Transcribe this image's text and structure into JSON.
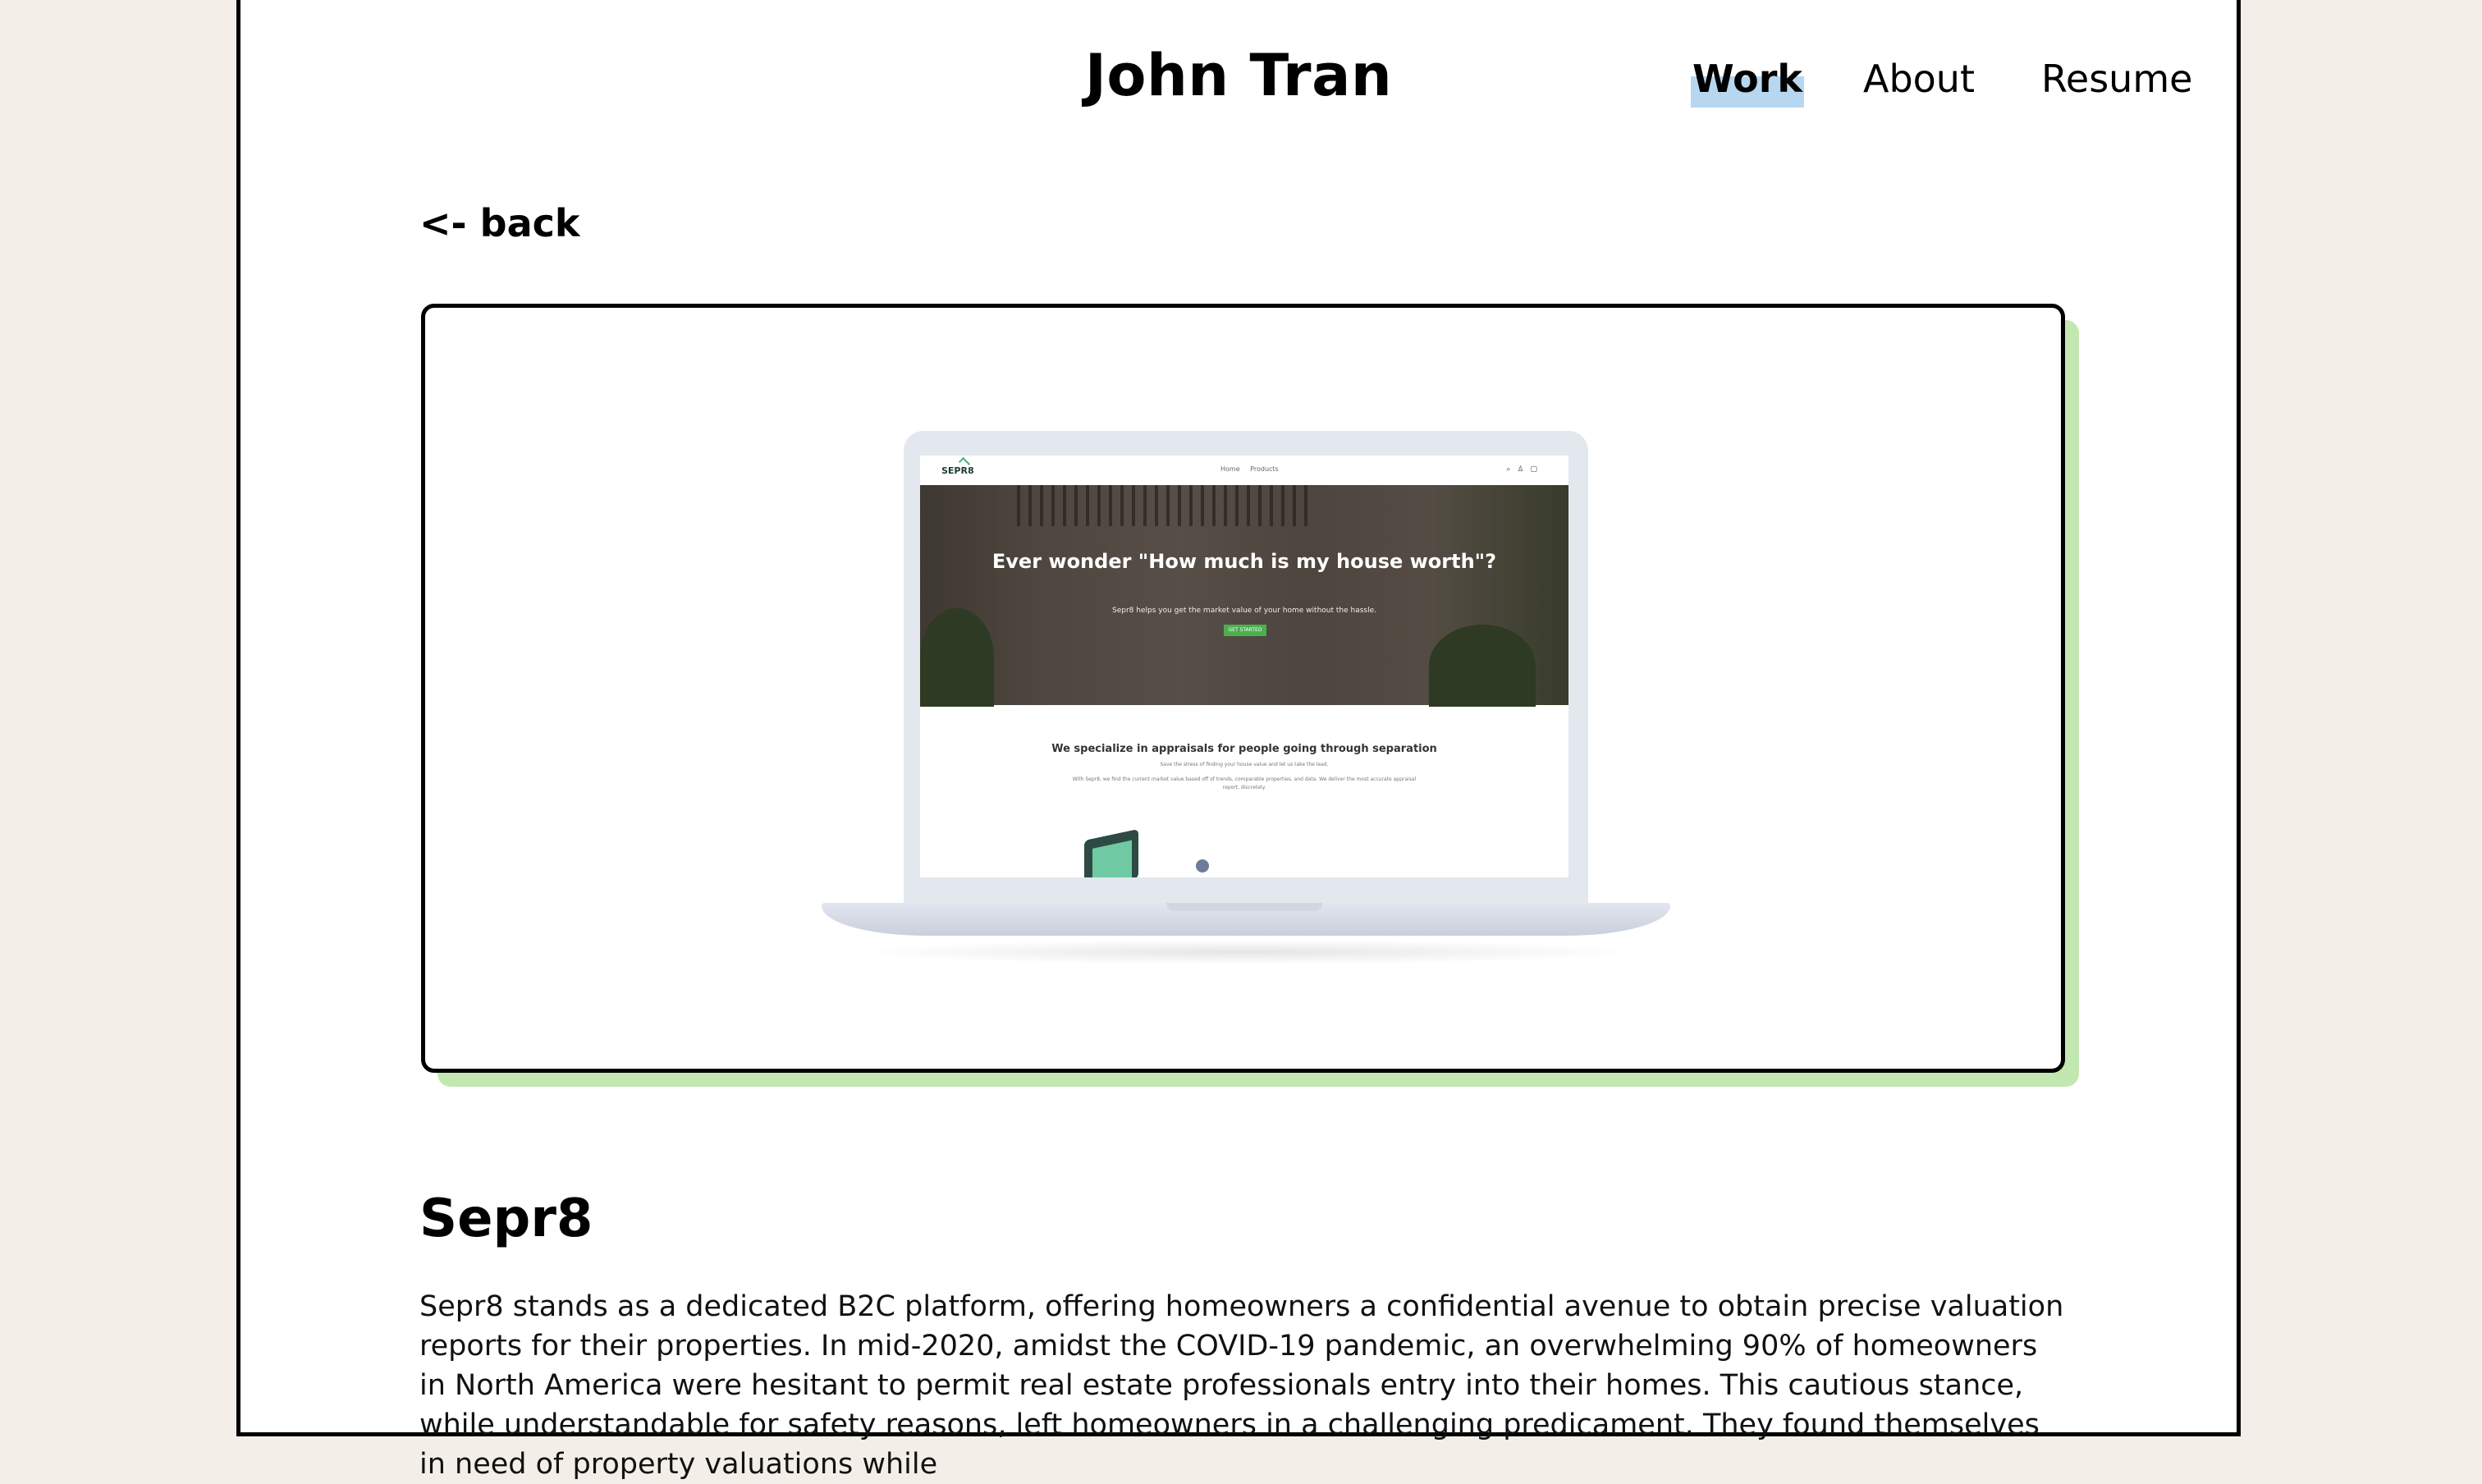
{
  "site": {
    "title": "John Tran"
  },
  "nav": {
    "items": [
      {
        "label": "Work",
        "active": true
      },
      {
        "label": "About",
        "active": false
      },
      {
        "label": "Resume",
        "active": false
      }
    ]
  },
  "back_link": {
    "label": "<- back"
  },
  "mockup": {
    "logo": "SEPR8",
    "links": [
      "Home",
      "Products"
    ],
    "hero_title": "Ever wonder \"How much is my house worth\"?",
    "hero_subtitle": "Sepr8 helps you get the market value of your home without the hassle.",
    "hero_button": "GET STARTED",
    "section_title": "We specialize in appraisals for people going through separation",
    "section_line1": "Save the stress of finding your house value and let us take the lead.",
    "section_line2": "With Sepr8, we find the current market value based off of trends, comparable properties, and data. We deliver the most accurate appraisal report, discretely."
  },
  "project": {
    "title": "Sepr8",
    "description": "Sepr8 stands as a dedicated B2C platform, offering homeowners a confidential avenue to obtain precise valuation reports for their properties. In mid-2020, amidst the COVID-19 pandemic, an overwhelming 90% of homeowners in North America were hesitant to permit real estate professionals entry into their homes. This cautious stance, while understandable for safety reasons, left homeowners in a challenging predicament. They found themselves in need of property valuations while"
  },
  "colors": {
    "page_bg": "#f3efe8",
    "card_shadow": "#c3e7b0",
    "nav_highlight": "#b7d7f0",
    "accent_green": "#4caf50"
  }
}
